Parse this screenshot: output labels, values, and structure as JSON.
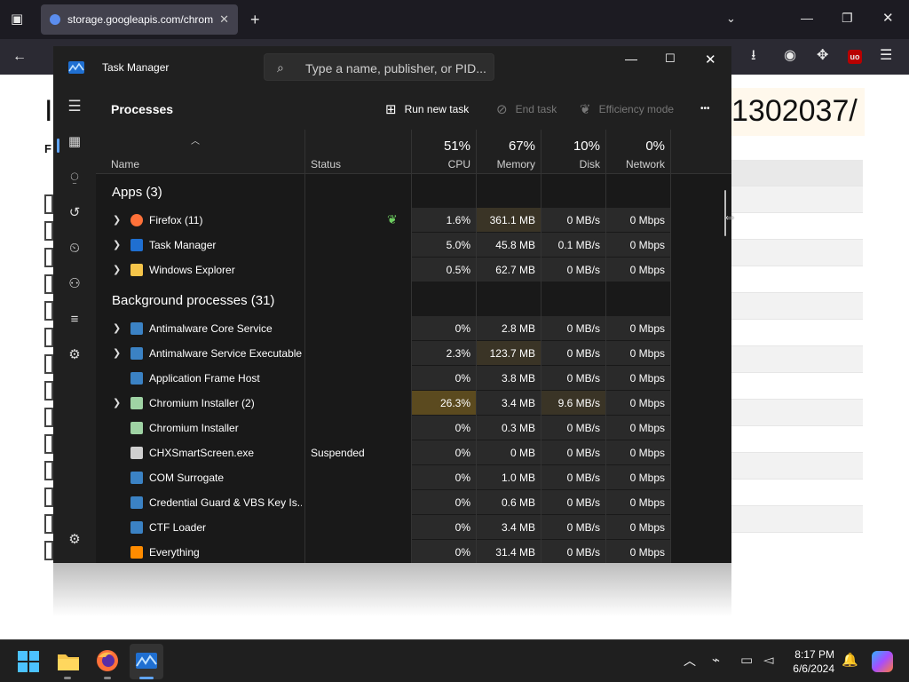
{
  "browser": {
    "tab_title": "storage.googleapis.com/chrom",
    "tab_close": "✕",
    "new_tab": "+"
  },
  "webpage": {
    "title_fragment": "1302037/",
    "left_big": "I",
    "left_label": "F"
  },
  "task_manager": {
    "window_title": "Task Manager",
    "search_placeholder": "Type a name, publisher, or PID...",
    "page_title": "Processes",
    "toolbar": {
      "run_new_task": "Run new task",
      "end_task": "End task",
      "efficiency_mode": "Efficiency mode",
      "more": "•••"
    },
    "columns": {
      "name": "Name",
      "status": "Status",
      "cpu_pct": "51%",
      "cpu": "CPU",
      "memory_pct": "67%",
      "memory": "Memory",
      "disk_pct": "10%",
      "disk": "Disk",
      "network_pct": "0%",
      "network": "Network"
    },
    "groups": {
      "apps": "Apps (3)",
      "background": "Background processes (31)"
    },
    "apps": [
      {
        "name": "Firefox (11)",
        "status": "",
        "cpu": "1.6%",
        "memory": "361.1 MB",
        "disk": "0 MB/s",
        "network": "0 Mbps",
        "expandable": true,
        "icon": "firefox-icon",
        "eco": true
      },
      {
        "name": "Task Manager",
        "status": "",
        "cpu": "5.0%",
        "memory": "45.8 MB",
        "disk": "0.1 MB/s",
        "network": "0 Mbps",
        "expandable": true,
        "icon": "task-manager-icon"
      },
      {
        "name": "Windows Explorer",
        "status": "",
        "cpu": "0.5%",
        "memory": "62.7 MB",
        "disk": "0 MB/s",
        "network": "0 Mbps",
        "expandable": true,
        "icon": "folder-icon"
      }
    ],
    "background": [
      {
        "name": "Antimalware Core Service",
        "status": "",
        "cpu": "0%",
        "memory": "2.8 MB",
        "disk": "0 MB/s",
        "network": "0 Mbps",
        "expandable": true,
        "icon": "service-icon"
      },
      {
        "name": "Antimalware Service Executable",
        "status": "",
        "cpu": "2.3%",
        "memory": "123.7 MB",
        "disk": "0 MB/s",
        "network": "0 Mbps",
        "expandable": true,
        "icon": "service-icon"
      },
      {
        "name": "Application Frame Host",
        "status": "",
        "cpu": "0%",
        "memory": "3.8 MB",
        "disk": "0 MB/s",
        "network": "0 Mbps",
        "expandable": false,
        "icon": "service-icon"
      },
      {
        "name": "Chromium Installer (2)",
        "status": "",
        "cpu": "26.3%",
        "memory": "3.4 MB",
        "disk": "9.6 MB/s",
        "network": "0 Mbps",
        "expandable": true,
        "icon": "installer-icon"
      },
      {
        "name": "Chromium Installer",
        "status": "",
        "cpu": "0%",
        "memory": "0.3 MB",
        "disk": "0 MB/s",
        "network": "0 Mbps",
        "expandable": false,
        "icon": "installer-icon"
      },
      {
        "name": "CHXSmartScreen.exe",
        "status": "Suspended",
        "cpu": "0%",
        "memory": "0 MB",
        "disk": "0 MB/s",
        "network": "0 Mbps",
        "expandable": false,
        "icon": "smartscreen-icon"
      },
      {
        "name": "COM Surrogate",
        "status": "",
        "cpu": "0%",
        "memory": "1.0 MB",
        "disk": "0 MB/s",
        "network": "0 Mbps",
        "expandable": false,
        "icon": "service-icon"
      },
      {
        "name": "Credential Guard & VBS Key Is...",
        "status": "",
        "cpu": "0%",
        "memory": "0.6 MB",
        "disk": "0 MB/s",
        "network": "0 Mbps",
        "expandable": false,
        "icon": "service-icon"
      },
      {
        "name": "CTF Loader",
        "status": "",
        "cpu": "0%",
        "memory": "3.4 MB",
        "disk": "0 MB/s",
        "network": "0 Mbps",
        "expandable": false,
        "icon": "service-icon"
      },
      {
        "name": "Everything",
        "status": "",
        "cpu": "0%",
        "memory": "31.4 MB",
        "disk": "0 MB/s",
        "network": "0 Mbps",
        "expandable": false,
        "icon": "search-app-icon"
      }
    ]
  },
  "taskbar": {
    "time": "8:17 PM",
    "date": "6/6/2024"
  },
  "colors": {
    "accent": "#60a5fa",
    "heat_light": "#2a2a2a",
    "heat_mid": "#3a3426",
    "heat_high": "#5b4a1f"
  }
}
